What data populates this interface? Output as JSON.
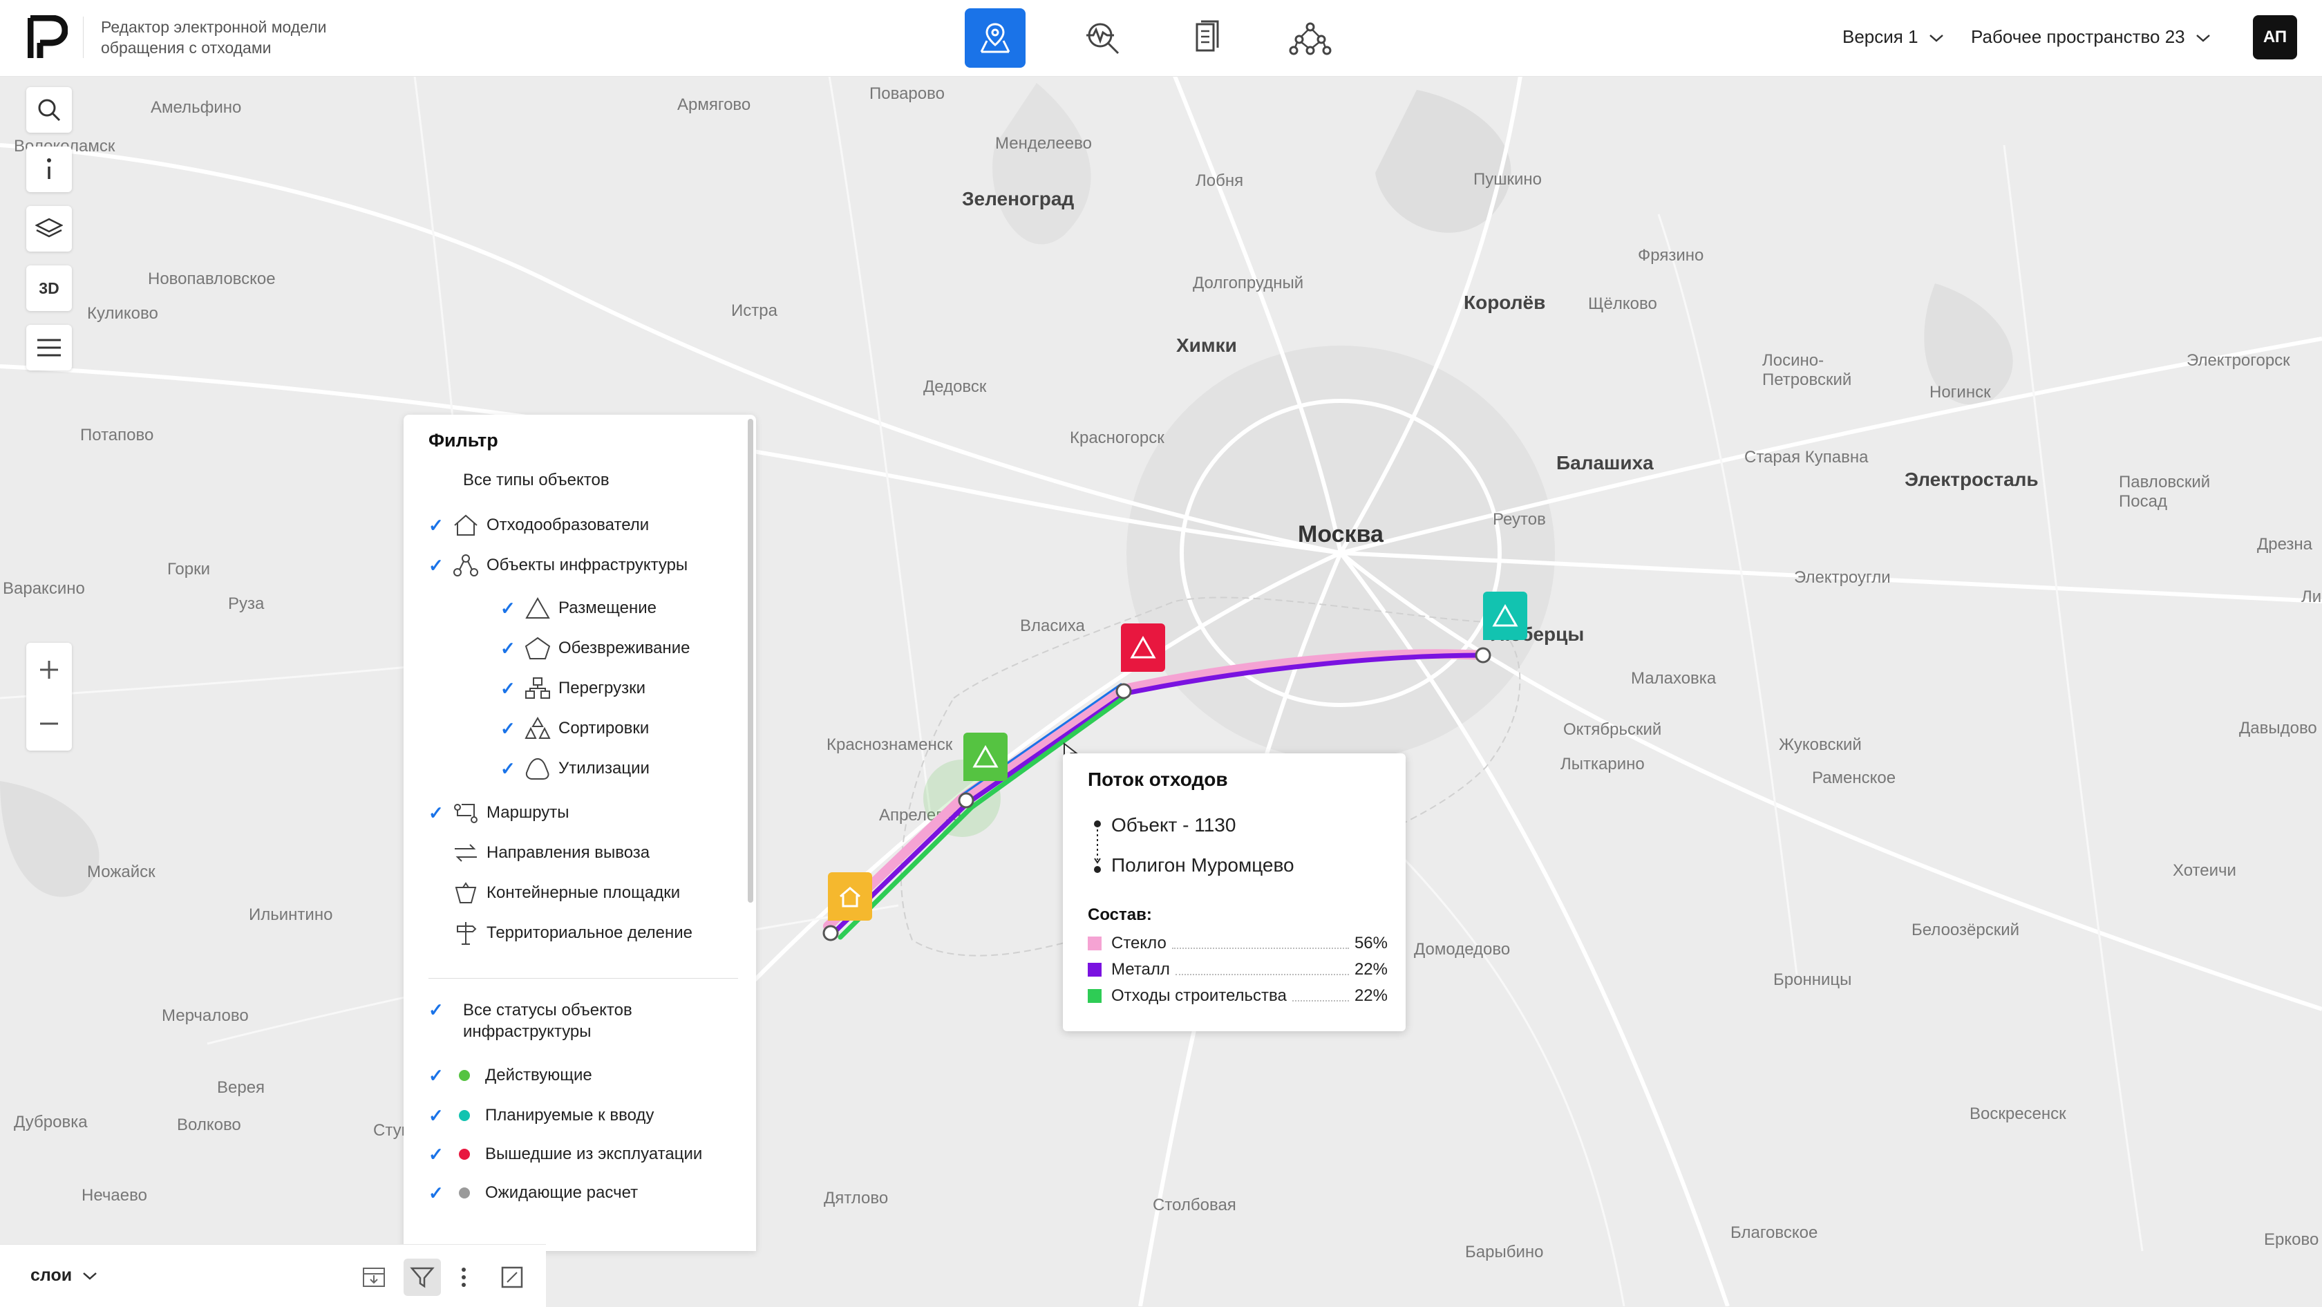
{
  "header": {
    "title": "Редактор электронной модели обращения с отходами",
    "nav": [
      {
        "name": "map-nav-button",
        "icon": "map-pin-icon",
        "active": true
      },
      {
        "name": "analytics-nav-button",
        "icon": "analytics-search-icon",
        "active": false
      },
      {
        "name": "documents-nav-button",
        "icon": "documents-icon",
        "active": false
      },
      {
        "name": "network-nav-button",
        "icon": "network-icon",
        "active": false
      }
    ],
    "version": "Версия 1",
    "workspace": "Рабочее пространство 23",
    "user_initials": "АП"
  },
  "tools": {
    "three_d": "3D"
  },
  "map_places": [
    {
      "name": "Амельфино"
    },
    {
      "name": "Армягово"
    },
    {
      "name": "Поварово"
    },
    {
      "name": "Менделеево"
    },
    {
      "name": "Волоколамск"
    },
    {
      "name": "Зеленоград"
    },
    {
      "name": "Лобня"
    },
    {
      "name": "Пушкино"
    },
    {
      "name": "Новопавловское"
    },
    {
      "name": "Куликово"
    },
    {
      "name": "Истра"
    },
    {
      "name": "Долгопрудный"
    },
    {
      "name": "Фрязино"
    },
    {
      "name": "Королёв"
    },
    {
      "name": "Щёлково"
    },
    {
      "name": "Химки"
    },
    {
      "name": "Дедовск"
    },
    {
      "name": "Лосино-Петровский"
    },
    {
      "name": "Ногинск"
    },
    {
      "name": "Электрогорск"
    },
    {
      "name": "Потапово"
    },
    {
      "name": "Красногорск"
    },
    {
      "name": "Балашиха"
    },
    {
      "name": "Старая Купавна"
    },
    {
      "name": "Электросталь"
    },
    {
      "name": "Павловский Посад"
    },
    {
      "name": "Москва"
    },
    {
      "name": "Реутов"
    },
    {
      "name": "Горки"
    },
    {
      "name": "Варaксино"
    },
    {
      "name": "Руза"
    },
    {
      "name": "Дрезна"
    },
    {
      "name": "Электроугли"
    },
    {
      "name": "Власиха"
    },
    {
      "name": "Люберцы"
    },
    {
      "name": "Малаховка"
    },
    {
      "name": "Октябрьский"
    },
    {
      "name": "Краснознаменск"
    },
    {
      "name": "Жуковский"
    },
    {
      "name": "Давыдово"
    },
    {
      "name": "Лыткарино"
    },
    {
      "name": "Раменское"
    },
    {
      "name": "Апрелевка"
    },
    {
      "name": "Можайск"
    },
    {
      "name": "Хотеичи"
    },
    {
      "name": "Ильинтино"
    },
    {
      "name": "Белоозёрский"
    },
    {
      "name": "Домодедово"
    },
    {
      "name": "Бронницы"
    },
    {
      "name": "Мерчалово"
    },
    {
      "name": "Верея"
    },
    {
      "name": "Дубровка"
    },
    {
      "name": "Волково"
    },
    {
      "name": "Воскресенск"
    },
    {
      "name": "Нечаево"
    },
    {
      "name": "Дятлово"
    },
    {
      "name": "Столбовая"
    },
    {
      "name": "Благовское"
    },
    {
      "name": "Барыбино"
    },
    {
      "name": "Ерково"
    },
    {
      "name": "Ступино"
    },
    {
      "name": "Липицы"
    }
  ],
  "filter": {
    "title": "Фильтр",
    "all_types": "Все типы объектов",
    "groups": [
      {
        "label": "Отходообразователи",
        "checked": true,
        "icon": "house-icon"
      },
      {
        "label": "Объекты инфраструктуры",
        "checked": true,
        "icon": "infrastructure-icon"
      },
      {
        "label": "Размещение",
        "checked": true,
        "icon": "triangle-icon"
      },
      {
        "label": "Обезвреживание",
        "checked": true,
        "icon": "pentagon-icon"
      },
      {
        "label": "Перегрузки",
        "checked": true,
        "icon": "transfer-icon"
      },
      {
        "label": "Сортировки",
        "checked": true,
        "icon": "sorting-icon"
      },
      {
        "label": "Утилизации",
        "checked": true,
        "icon": "recycle-icon"
      },
      {
        "label": "Маршруты",
        "checked": true,
        "icon": "route-icon"
      },
      {
        "label": "Направления вывоза",
        "checked": false,
        "icon": "directions-icon"
      },
      {
        "label": "Контейнерные площадки",
        "checked": false,
        "icon": "container-icon"
      },
      {
        "label": "Территориальное деление",
        "checked": false,
        "icon": "territory-icon"
      }
    ],
    "statuses_title": "Все статусы объектов инфраструктуры",
    "statuses": [
      {
        "label": "Действующие",
        "color": "#55c341",
        "checked": true
      },
      {
        "label": "Планируемые к вводу",
        "color": "#12c3b0",
        "checked": true
      },
      {
        "label": "Вышедшие из эксплуатации",
        "color": "#e8173f",
        "checked": true
      },
      {
        "label": "Ожидающие расчет",
        "color": "#9a9a9a",
        "checked": true
      }
    ]
  },
  "bottom_bar": {
    "layers_label": "слои"
  },
  "tooltip": {
    "title": "Поток отходов",
    "from": "Объект - 1130",
    "to": "Полигон Муромцево",
    "composition_title": "Состав:",
    "composition": [
      {
        "label": "Стекло",
        "value": "56%",
        "color": "#f5a3d3"
      },
      {
        "label": "Металл",
        "value": "22%",
        "color": "#7a12e0"
      },
      {
        "label": "Отходы строительства",
        "value": "22%",
        "color": "#2ecc55"
      }
    ]
  },
  "colors": {
    "accent": "#1a73e8",
    "glass": "#f5a3d3",
    "metal": "#7a12e0",
    "construction": "#2ecc55",
    "pin_red": "#e8173f",
    "pin_green": "#55c341",
    "pin_teal": "#12c3b0",
    "pin_yellow": "#f5b82e"
  }
}
